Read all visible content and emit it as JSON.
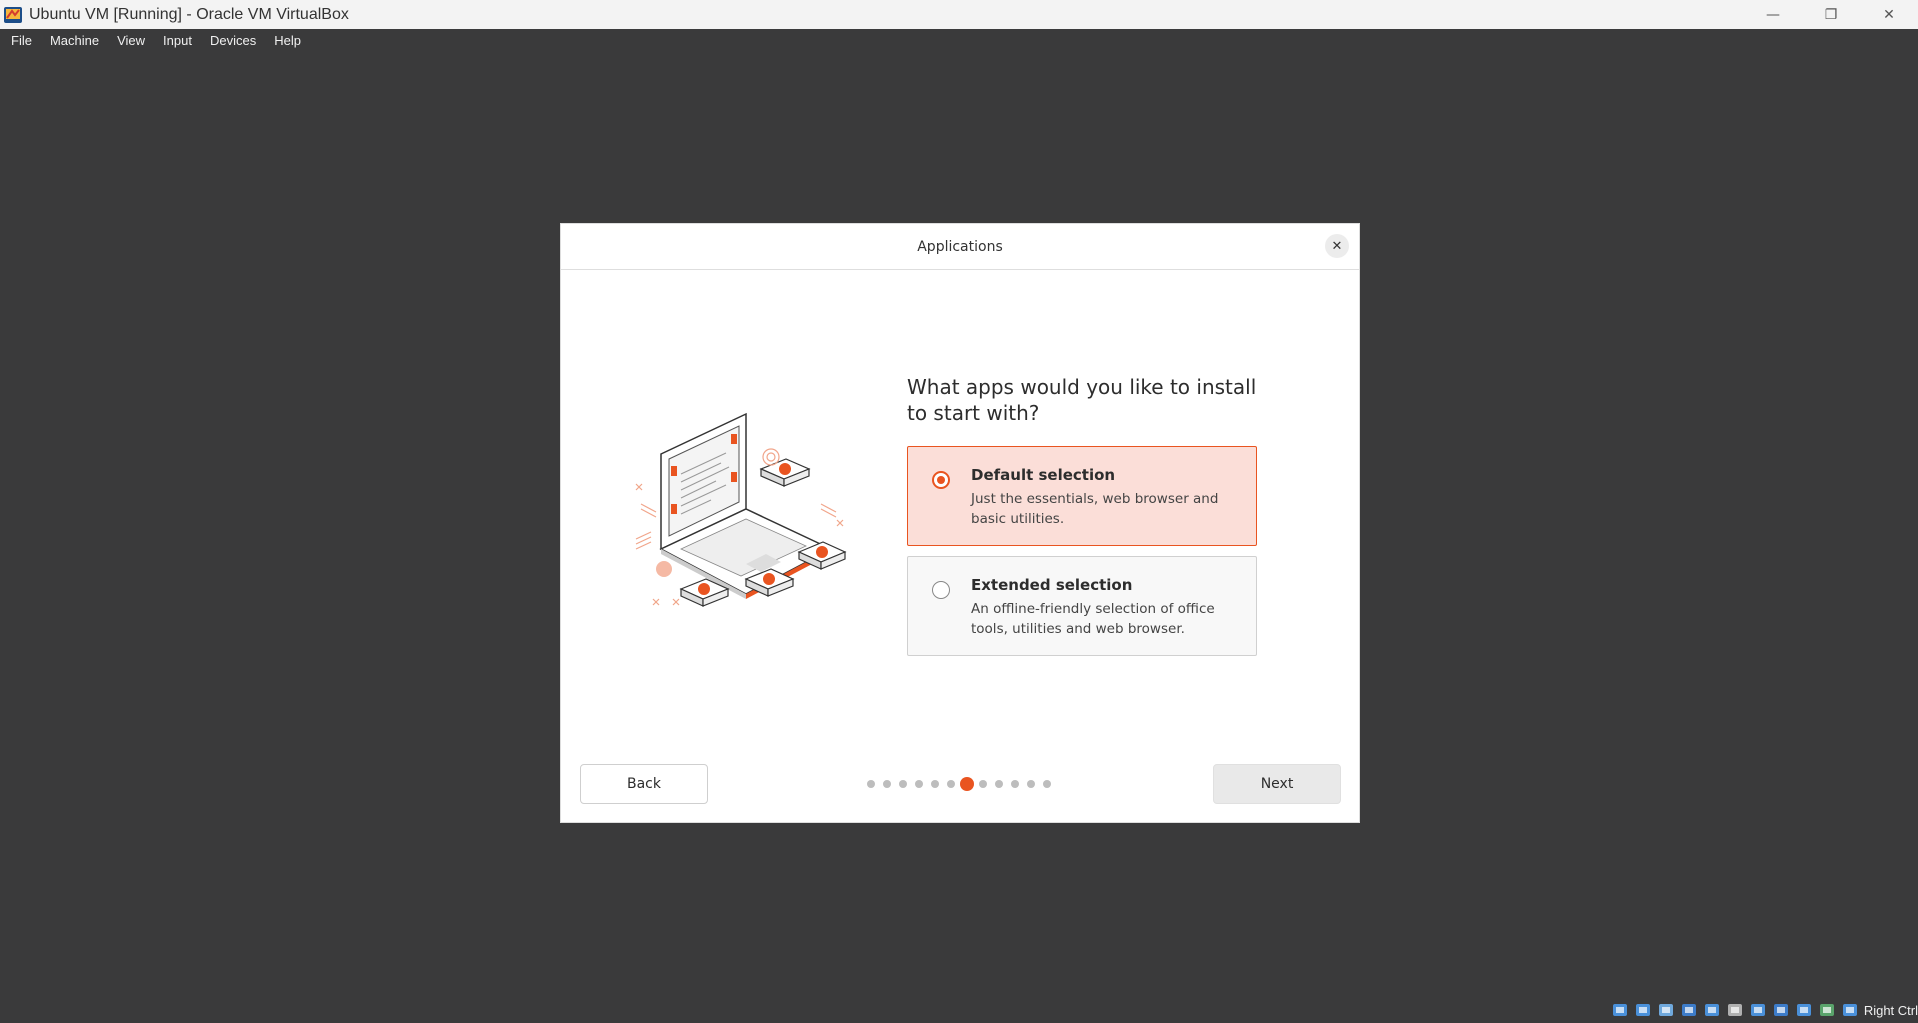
{
  "window": {
    "title": "Ubuntu VM [Running] - Oracle VM VirtualBox",
    "minimize_glyph": "—",
    "restore_glyph": "❐",
    "close_glyph": "✕"
  },
  "menu": [
    "File",
    "Machine",
    "View",
    "Input",
    "Devices",
    "Help"
  ],
  "dialog": {
    "title": "Applications",
    "close_glyph": "✕",
    "question": "What apps would you like to install to start with?",
    "options": [
      {
        "title": "Default selection",
        "description": "Just the essentials, web browser and basic utilities.",
        "selected": true
      },
      {
        "title": "Extended selection",
        "description": "An offline-friendly selection of office tools, utilities and web browser.",
        "selected": false
      }
    ],
    "back_label": "Back",
    "next_label": "Next",
    "progress": {
      "total_steps": 12,
      "current_step": 7
    }
  },
  "statusbar": {
    "icons": [
      "hard-disk-icon",
      "optical-drive-icon",
      "audio-icon",
      "network-icon",
      "usb-icon",
      "shared-folders-icon",
      "display-icon",
      "screen-recording-icon",
      "virtualization-icon",
      "mouse-integration-icon",
      "keyboard-icon"
    ],
    "host_key": "Right Ctrl"
  },
  "colors": {
    "accent": "#e95420",
    "selected_bg": "#fbded8",
    "host_bg": "#3a3a3b"
  }
}
